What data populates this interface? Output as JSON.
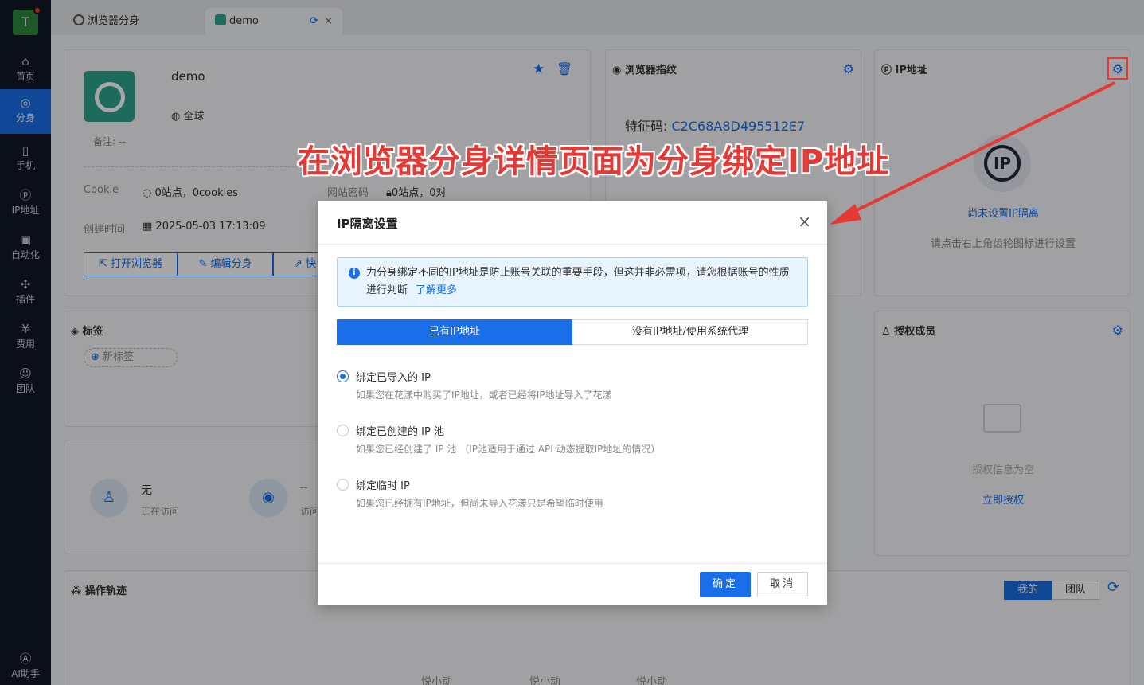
{
  "sidebar": {
    "avatar_letter": "T",
    "items": [
      {
        "label": "首页",
        "icon": "home-icon"
      },
      {
        "label": "分身",
        "icon": "chrome-icon"
      },
      {
        "label": "手机",
        "icon": "phone-icon"
      },
      {
        "label": "IP地址",
        "icon": "ip-icon"
      },
      {
        "label": "自动化",
        "icon": "robot-icon"
      },
      {
        "label": "插件",
        "icon": "puzzle-icon"
      },
      {
        "label": "费用",
        "icon": "yuan-icon"
      },
      {
        "label": "团队",
        "icon": "team-icon"
      }
    ],
    "ai_label": "AI助手"
  },
  "tabs": [
    {
      "label": "浏览器分身"
    },
    {
      "label": "demo"
    }
  ],
  "profile": {
    "name": "demo",
    "region": "全球",
    "note": "备注: --",
    "cookie_label": "Cookie",
    "cookie_value": "0站点，0cookies",
    "password_label": "网站密码",
    "password_value": "0站点，0对",
    "created_label": "创建时间",
    "created_value": "2025-05-03 17:13:09",
    "btn_open": "打开浏览器",
    "btn_edit": "编辑分身",
    "btn_fast": "快"
  },
  "fingerprint": {
    "title": "浏览器指纹",
    "code_label": "特征码:",
    "code_value": "C2C68A8D495512E7"
  },
  "ip_card": {
    "title": "IP地址",
    "status": "尚未设置IP隔离",
    "hint": "请点击右上角齿轮图标进行设置"
  },
  "tags": {
    "title": "标签",
    "new_tag": "新标签"
  },
  "visit": {
    "value1": "无",
    "label1": "正在访问",
    "value2": "--",
    "label2": "访问"
  },
  "members": {
    "title": "授权成员",
    "empty": "授权信息为空",
    "action": "立即授权"
  },
  "track": {
    "title": "操作轨迹",
    "seg_mine": "我的",
    "seg_team": "团队",
    "watermark": "悦小动"
  },
  "annotation": "在浏览器分身详情页面为分身绑定IP地址",
  "modal": {
    "title": "IP隔离设置",
    "alert_text": "为分身绑定不同的IP地址是防止账号关联的重要手段，但这并非必需项，请您根据账号的性质进行判断",
    "alert_link": "了解更多",
    "seg_on": "已有IP地址",
    "seg_off": "没有IP地址/使用系统代理",
    "options": [
      {
        "label": "绑定已导入的 IP",
        "desc": "如果您在花漾中购买了IP地址，或者已经将IP地址导入了花漾",
        "selected": true
      },
      {
        "label": "绑定已创建的 IP 池",
        "desc": "如果您已经创建了 IP 池 （IP池适用于通过 API 动态提取IP地址的情况）",
        "selected": false
      },
      {
        "label": "绑定临时 IP",
        "desc": "如果您已经拥有IP地址，但尚未导入花漾只是希望临时使用",
        "selected": false
      }
    ],
    "ok": "确定",
    "cancel": "取消"
  }
}
